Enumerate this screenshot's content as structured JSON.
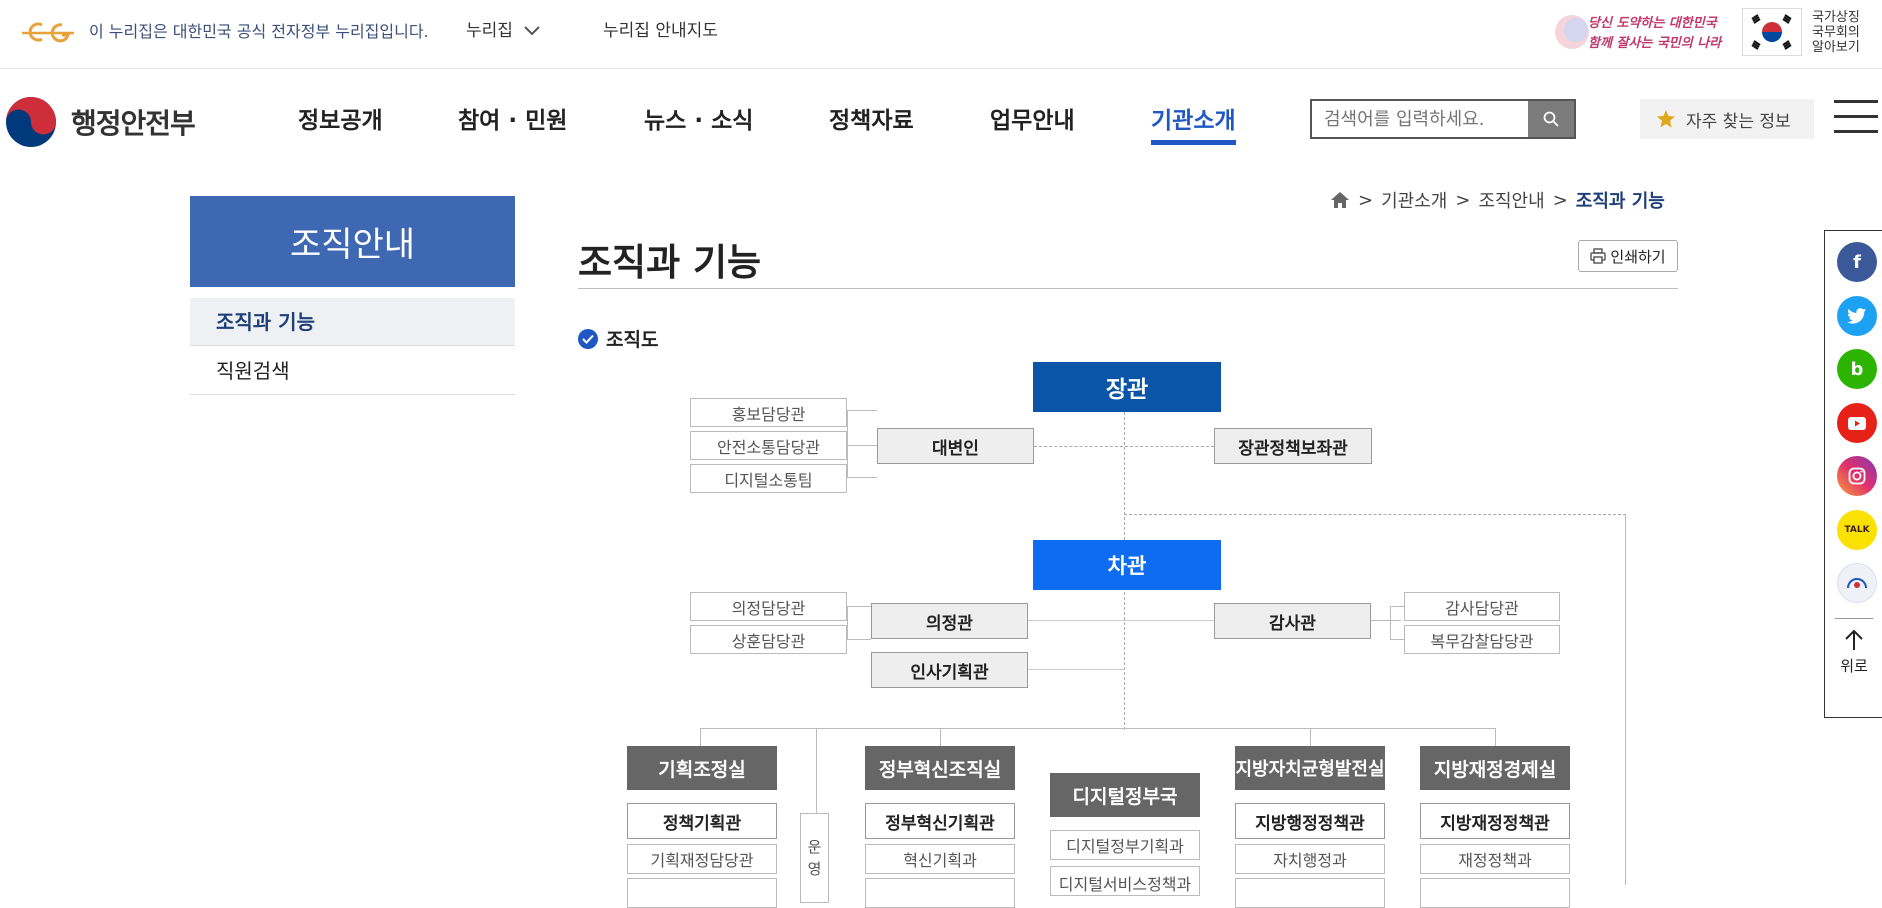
{
  "topbar": {
    "notice": "이 누리집은 대한민국 공식 전자정부 누리집입니다.",
    "nuri_menu": "누리집",
    "nuri_guide": "누리집 안내지도",
    "slogan_line1": "당신 도약하는 대한민국",
    "slogan_line2": "함께 잘사는 국민의 나라",
    "flag_label": "국가상징 국무회의 알아보기"
  },
  "header": {
    "logo_text": "행정안전부",
    "nav": [
      "정보공개",
      "참여 · 민원",
      "뉴스 · 소식",
      "정책자료",
      "업무안내",
      "기관소개"
    ],
    "active_nav": "기관소개",
    "search_placeholder": "검색어를 입력하세요.",
    "fav_label": "자주 찾는 정보"
  },
  "lnb": {
    "title": "조직안내",
    "items": [
      "조직과 기능",
      "직원검색"
    ]
  },
  "breadcrumb": {
    "items": [
      "기관소개",
      "조직안내"
    ],
    "current": "조직과 기능"
  },
  "content": {
    "title": "조직과 기능",
    "print": "인쇄하기",
    "section": "조직도"
  },
  "org": {
    "minister": "장관",
    "spokesperson": "대변인",
    "policy_aide": "장관정책보좌관",
    "minister_left": [
      "홍보담당관",
      "안전소통담당관",
      "디지털소통팀"
    ],
    "vice": "차관",
    "assembly": "의정관",
    "inspector": "감사관",
    "hr": "인사기획관",
    "vice_left": [
      "의정담당관",
      "상훈담당관"
    ],
    "vice_right": [
      "감사담당관",
      "복무감찰담당관"
    ],
    "operation_vert": "운영",
    "offices": [
      {
        "name": "기획조정실",
        "sub": "정책기획관",
        "items": [
          "기획재정담당관"
        ]
      },
      {
        "name": "정부혁신조직실",
        "sub": "정부혁신기획관",
        "items": [
          "혁신기획과"
        ]
      },
      {
        "name": "디지털정부국",
        "sub": "",
        "items": [
          "디지털정부기획과",
          "디지털서비스정책과"
        ]
      },
      {
        "name": "지방자치균형발전실",
        "sub": "지방행정정책관",
        "items": [
          "자치행정과"
        ]
      },
      {
        "name": "지방재정경제실",
        "sub": "지방재정정책관",
        "items": [
          "재정정책과"
        ]
      }
    ]
  },
  "share": {
    "up_label": "위로"
  }
}
